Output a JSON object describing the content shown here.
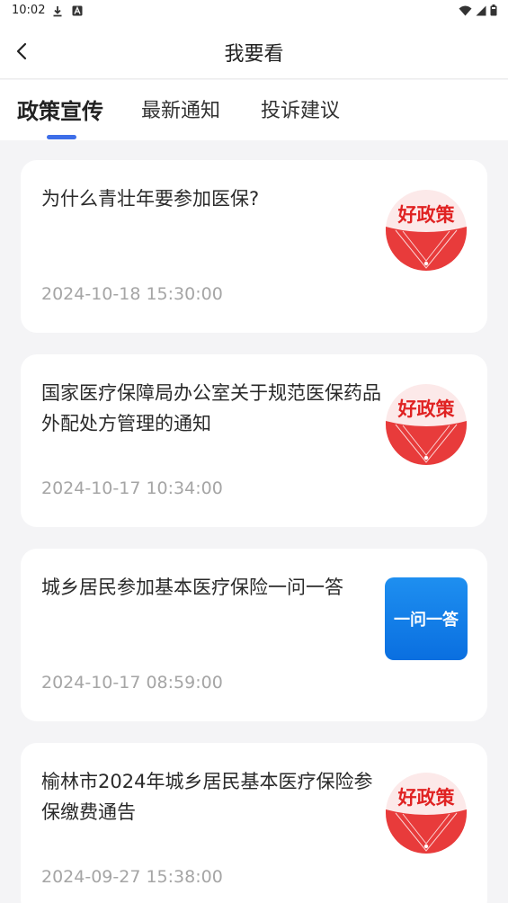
{
  "status_bar": {
    "time": "10:02",
    "icons_left": [
      "download-icon",
      "font-a-icon"
    ],
    "icons_right": [
      "wifi-icon",
      "signal-icon",
      "battery-icon"
    ]
  },
  "header": {
    "title": "我要看",
    "back_icon": "chevron-left-icon"
  },
  "tabs": [
    {
      "label": "政策宣传",
      "active": true
    },
    {
      "label": "最新通知",
      "active": false
    },
    {
      "label": "投诉建议",
      "active": false
    }
  ],
  "accent_color": "#3d6ee8",
  "articles": [
    {
      "title": "为什么青壮年要参加医保?",
      "date": "2024-10-18 15:30:00",
      "badge_text": "好政策",
      "badge_type": "policy"
    },
    {
      "title": "国家医疗保障局办公室关于规范医保药品外配处方管理的通知",
      "date": "2024-10-17 10:34:00",
      "badge_text": "好政策",
      "badge_type": "policy"
    },
    {
      "title": "城乡居民参加基本医疗保险一问一答",
      "date": "2024-10-17 08:59:00",
      "badge_text": "一问一答",
      "badge_type": "qa"
    },
    {
      "title": "榆林市2024年城乡居民基本医疗保险参保缴费通告",
      "date": "2024-09-27 15:38:00",
      "badge_text": "好政策",
      "badge_type": "policy"
    }
  ]
}
